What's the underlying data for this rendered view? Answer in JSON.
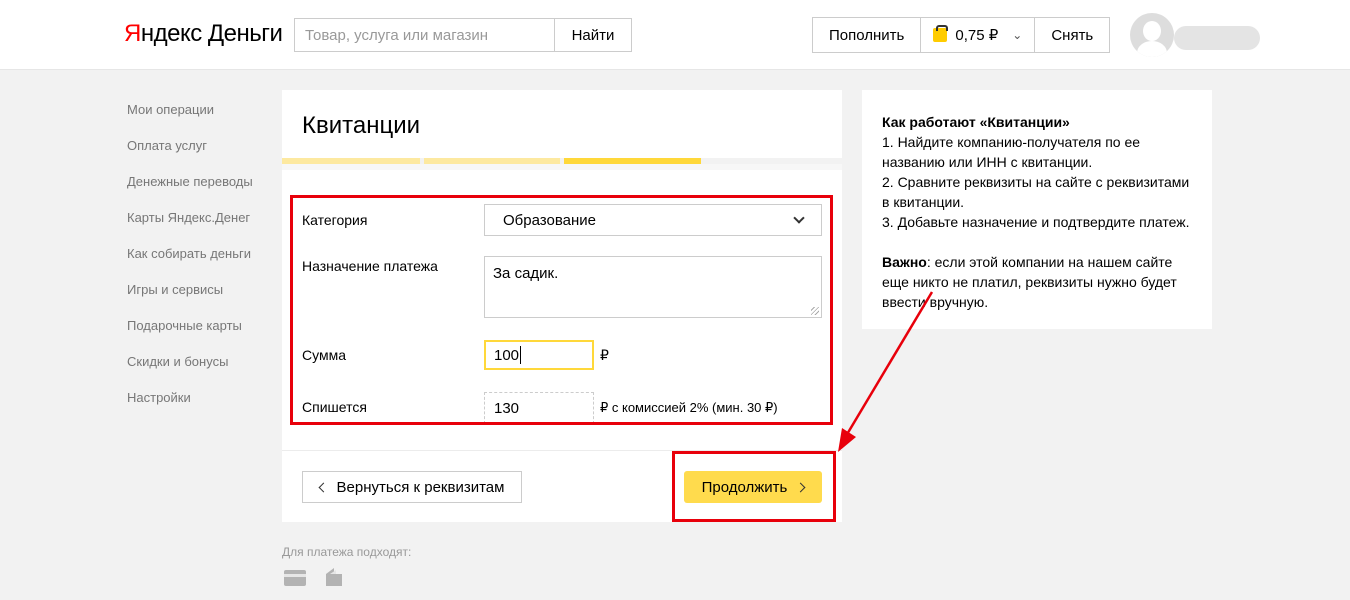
{
  "header": {
    "logo_first": "Я",
    "logo_rest": "ндекс Деньги",
    "search_placeholder": "Товар, услуга или магазин",
    "search_button": "Найти",
    "topup_label": "Пополнить",
    "balance": "0,75 ₽",
    "withdraw_label": "Снять"
  },
  "sidebar": {
    "items": [
      {
        "label": "Мои операции"
      },
      {
        "label": "Оплата услуг"
      },
      {
        "label": "Денежные переводы"
      },
      {
        "label": "Карты Яндекс.Денег"
      },
      {
        "label": "Как собирать деньги"
      },
      {
        "label": "Игры и сервисы"
      },
      {
        "label": "Подарочные карты"
      },
      {
        "label": "Скидки и бонусы"
      },
      {
        "label": "Настройки"
      }
    ]
  },
  "main": {
    "title": "Квитанции",
    "progress_steps_total": 3,
    "progress_active_step": 3,
    "category_label": "Категория",
    "category_value": "Образование",
    "purpose_label": "Назначение платежа",
    "purpose_value": "За садик.",
    "amount_label": "Сумма",
    "amount_value": "100",
    "currency": "₽",
    "debit_label": "Спишется",
    "debit_value": "130",
    "commission_text": "₽ с комиссией 2% (мин. 30 ₽)",
    "back_button": "Вернуться к реквизитам",
    "continue_button": "Продолжить",
    "payment_methods_label": "Для платежа подходят:"
  },
  "info": {
    "title": "Как работают «Квитанции»",
    "step1": "1. Найдите компанию-получателя по ее названию или ИНН с квитанции.",
    "step2": "2. Сравните реквизиты на сайте с реквизитами в квитанции.",
    "step3": "3. Добавьте назначение и подтвердите платеж.",
    "important_label": "Важно",
    "important_text": ": если этой компании на нашем сайте еще никто не платил, реквизиты нужно будет ввести вручную."
  },
  "colors": {
    "accent_yellow": "#ffdb4d",
    "annotation_red": "#e8000b",
    "logo_red": "#ff0000"
  }
}
